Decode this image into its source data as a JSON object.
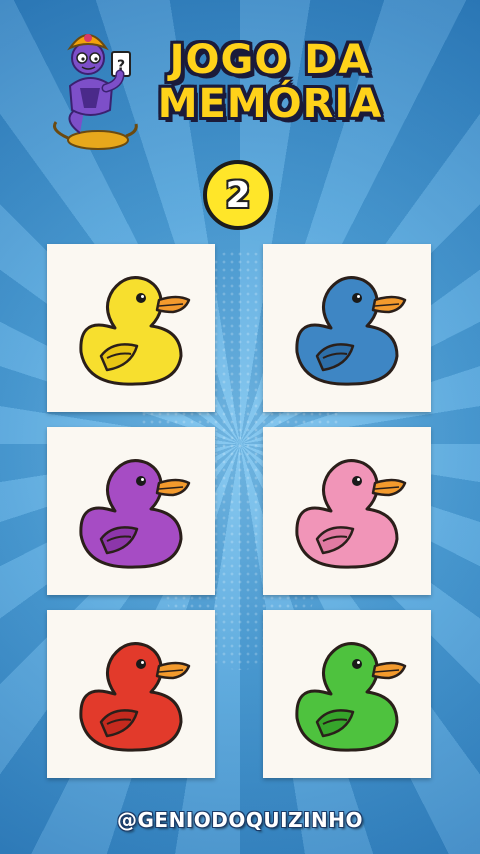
{
  "title": {
    "line1": "JOGO DA",
    "line2": "MEMÓRIA"
  },
  "counter": "2",
  "cards": [
    {
      "name": "yellow-duck-card",
      "body": "#f7df2e",
      "shade": "#e8c514"
    },
    {
      "name": "blue-duck-card",
      "body": "#3e86c4",
      "shade": "#2d6ea8"
    },
    {
      "name": "purple-duck-card",
      "body": "#a64cc4",
      "shade": "#8c36aa"
    },
    {
      "name": "pink-duck-card",
      "body": "#f195b8",
      "shade": "#e07aa2"
    },
    {
      "name": "red-duck-card",
      "body": "#e23a2b",
      "shade": "#c52a1e"
    },
    {
      "name": "green-duck-card",
      "body": "#4ec23e",
      "shade": "#36a52b"
    }
  ],
  "handle": "@GENIODOQUIZINHO",
  "colors": {
    "title": "#ffd21a",
    "counter": "#ffe629",
    "beak": "#f39a2d"
  }
}
